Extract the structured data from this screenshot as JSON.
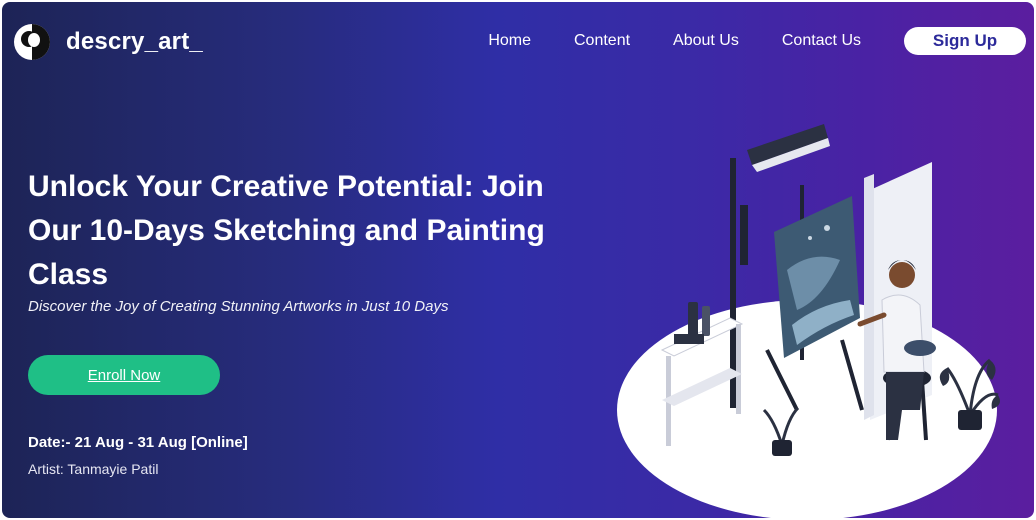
{
  "brand": {
    "name": "descry_art_"
  },
  "nav": {
    "home": "Home",
    "content": "Content",
    "about": "About Us",
    "contact": "Contact Us",
    "signup": "Sign Up"
  },
  "hero": {
    "headline": "Unlock Your Creative Potential: Join Our 10-Days Sketching and Painting Class",
    "subtitle": "Discover the Joy of Creating Stunning Artworks in Just 10 Days",
    "cta": "Enroll Now",
    "date": "Date:- 21 Aug - 31 Aug [Online]",
    "artist": "Artist: Tanmayie Patil"
  },
  "colors": {
    "cta": "#1fbf86",
    "gradient_start": "#1d2456",
    "gradient_end": "#5b1e9f"
  }
}
